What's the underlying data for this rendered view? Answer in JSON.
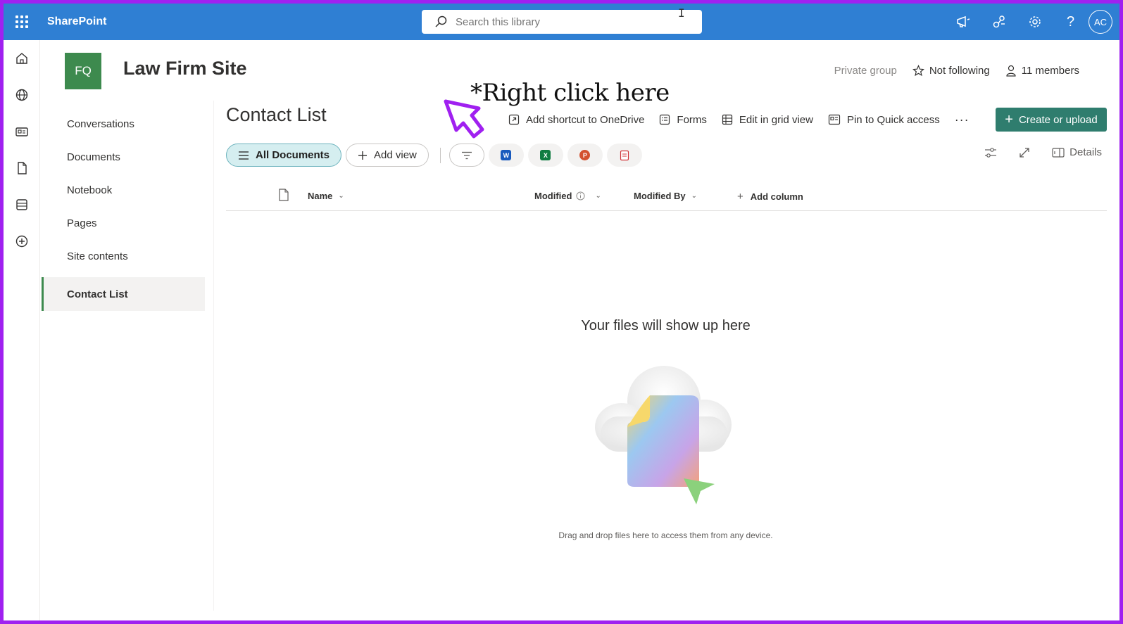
{
  "suite": {
    "brand": "SharePoint",
    "search_placeholder": "Search this library",
    "avatar_initials": "AC"
  },
  "site": {
    "logo_initials": "FQ",
    "title": "Law Firm Site",
    "privacy": "Private group",
    "follow_status": "Not following",
    "members": "11 members"
  },
  "leftnav": {
    "items": [
      {
        "label": "Conversations"
      },
      {
        "label": "Documents"
      },
      {
        "label": "Notebook"
      },
      {
        "label": "Pages"
      },
      {
        "label": "Site contents"
      }
    ],
    "active": "Contact List"
  },
  "library": {
    "title": "Contact List",
    "commands": {
      "add_shortcut": "Add shortcut to OneDrive",
      "forms": "Forms",
      "grid_view": "Edit in grid view",
      "pin": "Pin to Quick access",
      "more": "···",
      "create": "Create or upload"
    },
    "views": {
      "all_documents": "All Documents",
      "add_view": "Add view"
    },
    "details": "Details",
    "columns": {
      "name": "Name",
      "modified": "Modified",
      "modified_by": "Modified By",
      "add_column": "Add column"
    },
    "empty": {
      "title": "Your files will show up here",
      "subtitle": "Drag and drop files here to access them from any device."
    }
  },
  "annotation": {
    "text": "*Right click here"
  },
  "colors": {
    "suitebar": "#2f7fd3",
    "site_logo": "#3d8a4e",
    "create_button": "#2f7d6e",
    "view_pill": "#d5eef0",
    "frame": "#a020f0"
  }
}
